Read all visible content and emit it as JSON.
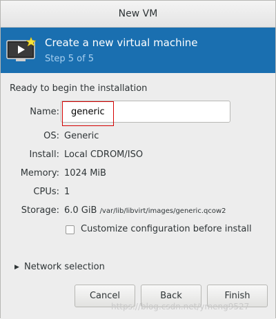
{
  "window": {
    "title": "New VM"
  },
  "banner": {
    "title": "Create a new virtual machine",
    "step": "Step 5 of 5",
    "icon": "monitor-play-icon"
  },
  "summary": {
    "heading": "Ready to begin the installation",
    "name_label": "Name:",
    "name_value": "generic",
    "os_label": "OS:",
    "os_value": "Generic",
    "install_label": "Install:",
    "install_value": "Local CDROM/ISO",
    "memory_label": "Memory:",
    "memory_value": "1024 MiB",
    "cpus_label": "CPUs:",
    "cpus_value": "1",
    "storage_label": "Storage:",
    "storage_size": "6.0 GiB",
    "storage_path": "/var/lib/libvirt/images/generic.qcow2",
    "customize_label": "Customize configuration before install",
    "customize_checked": false
  },
  "network": {
    "label": "Network selection",
    "expanded": false
  },
  "buttons": {
    "cancel": "Cancel",
    "back": "Back",
    "finish": "Finish"
  },
  "watermark": "https://blog.csdn.net/ymeng9527"
}
